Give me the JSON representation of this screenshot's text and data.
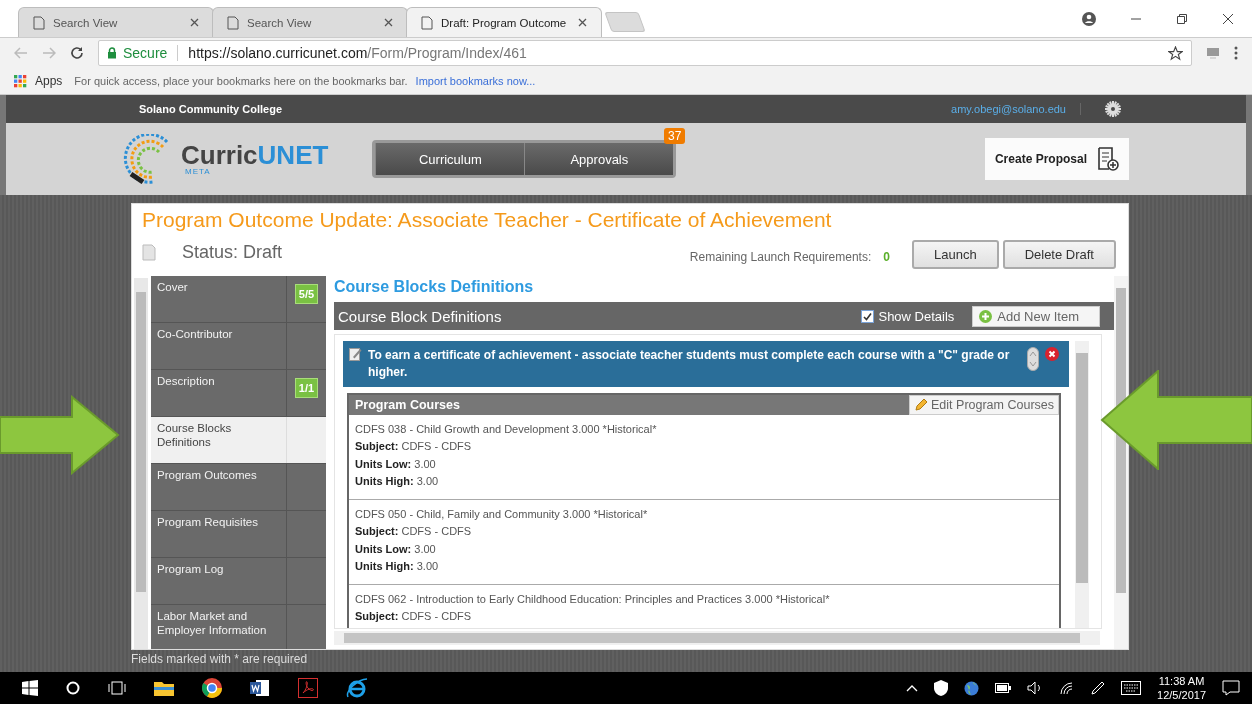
{
  "browser": {
    "tabs": [
      {
        "title": "Search View",
        "selected": false
      },
      {
        "title": "Search View",
        "selected": false
      },
      {
        "title": "Draft: Program Outcome",
        "selected": true
      }
    ],
    "security": "Secure",
    "url_host": "https://solano.curricunet.com",
    "url_path": "/Form/Program/Index/461",
    "bookmarks": {
      "apps": "Apps",
      "hint": "For quick access, place your bookmarks here on the bookmarks bar.",
      "link": "Import bookmarks now..."
    }
  },
  "site": {
    "college": "Solano Community College",
    "user": "amy.obegi@solano.edu",
    "logo_main": "Curric",
    "logo_accent": "UNET",
    "logo_sub": "META",
    "nav": [
      {
        "label": "Curriculum"
      },
      {
        "label": "Approvals",
        "badge": "37"
      }
    ],
    "create_proposal": "Create Proposal"
  },
  "proposal": {
    "title": "Program Outcome Update: Associate Teacher - Certificate of Achievement",
    "status": "Status: Draft",
    "requirements_label": "Remaining Launch Requirements:",
    "requirements_count": "0",
    "buttons": [
      "Launch",
      "Delete Draft"
    ]
  },
  "sidebar": {
    "items": [
      {
        "label": "Cover",
        "badge": "5/5",
        "selected": false
      },
      {
        "label": "Co-Contributor",
        "selected": false
      },
      {
        "label": "Description",
        "badge": "1/1",
        "selected": false
      },
      {
        "label": "Course Blocks Definitions",
        "selected": true
      },
      {
        "label": "Program Outcomes",
        "selected": false
      },
      {
        "label": "Program Requisites",
        "selected": false
      },
      {
        "label": "Program Log",
        "selected": false
      },
      {
        "label": "Labor Market and Employer Information",
        "selected": false
      }
    ]
  },
  "content": {
    "heading": "Course Blocks Definitions",
    "panel_title": "Course Block Definitions",
    "show_details": {
      "label": "Show Details",
      "checked": true
    },
    "add_button": "Add New Item",
    "block": {
      "text": "To earn a certificate of achievement - associate teacher students must complete each course with a \"C\" grade or higher.",
      "courses_title": "Program Courses",
      "edit_button": "Edit Program Courses",
      "courses": [
        {
          "title": "CDFS 038 - Child Growth and Development 3.000 *Historical*",
          "fields": [
            {
              "label": "Subject:",
              "value": "CDFS - CDFS"
            },
            {
              "label": "Units Low:",
              "value": "3.00"
            },
            {
              "label": "Units High:",
              "value": "3.00"
            }
          ]
        },
        {
          "title": "CDFS 050 - Child, Family and Community 3.000 *Historical*",
          "fields": [
            {
              "label": "Subject:",
              "value": "CDFS - CDFS"
            },
            {
              "label": "Units Low:",
              "value": "3.00"
            },
            {
              "label": "Units High:",
              "value": "3.00"
            }
          ]
        },
        {
          "title": "CDFS 062 - Introduction to Early Childhood Education: Principles and Practices 3.000 *Historical*",
          "fields": [
            {
              "label": "Subject:",
              "value": "CDFS - CDFS"
            }
          ]
        }
      ]
    }
  },
  "footer_note": "Fields marked with * are required",
  "taskbar": {
    "time": "11:38 AM",
    "date": "12/5/2017"
  }
}
